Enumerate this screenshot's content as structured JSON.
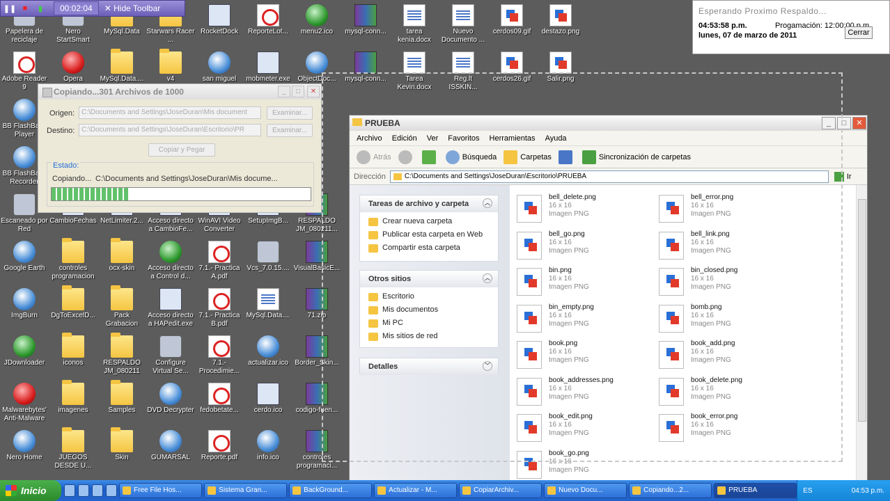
{
  "toolbar": {
    "time": "00:02:04",
    "hide_label": "Hide Toolbar"
  },
  "notification": {
    "title": "Esperando Proximo Respaldo...",
    "time": "04:53:58 p.m.",
    "prog_label": "Progamación: 12:00:00 p.m.",
    "date": "lunes, 07 de marzo de 2011",
    "close_label": "Cerrar"
  },
  "desktop_icons": [
    {
      "label": "Papelera de reciclaje",
      "icon": "recycle-bin-icon",
      "kind": "gear"
    },
    {
      "label": "Nero StartSmart",
      "icon": "nero-icon",
      "kind": "gear"
    },
    {
      "label": "MySql.Data",
      "icon": "folder-icon",
      "kind": "folder"
    },
    {
      "label": "Starwars Racer ...",
      "icon": "folder-icon",
      "kind": "folder"
    },
    {
      "label": "RocketDock",
      "icon": "rocketdock-icon",
      "kind": "prog"
    },
    {
      "label": "ReporteLot...",
      "icon": "pdf-icon",
      "kind": "pdf"
    },
    {
      "label": "menu2.ico",
      "icon": "ico-file-icon",
      "kind": "green"
    },
    {
      "label": "mysql-conn...",
      "icon": "rar-icon",
      "kind": "rar"
    },
    {
      "label": "tarea kenia.docx",
      "icon": "word-doc-icon",
      "kind": "doc"
    },
    {
      "label": "Nuevo Documento ...",
      "icon": "text-doc-icon",
      "kind": "doc"
    },
    {
      "label": "cerdos09.gif",
      "icon": "image-icon",
      "kind": "img"
    },
    {
      "label": "destazo.png",
      "icon": "image-icon",
      "kind": "img"
    },
    {
      "label": "Adobe Reader 9",
      "icon": "adobe-reader-icon",
      "kind": "pdf"
    },
    {
      "label": "Opera",
      "icon": "opera-icon",
      "kind": "red"
    },
    {
      "label": "MySql.Data....",
      "icon": "folder-icon",
      "kind": "folder"
    },
    {
      "label": "v4",
      "icon": "folder-icon",
      "kind": "folder"
    },
    {
      "label": "san miguel",
      "icon": "globe-icon",
      "kind": "round"
    },
    {
      "label": "mobmeter.exe",
      "icon": "monitor-icon",
      "kind": "prog"
    },
    {
      "label": "ObjectDoc...",
      "icon": "objectdoc-icon",
      "kind": "round"
    },
    {
      "label": "mysql-conn...",
      "icon": "rar-icon",
      "kind": "rar"
    },
    {
      "label": "Tarea Kevin.docx",
      "icon": "word-doc-icon",
      "kind": "doc"
    },
    {
      "label": "Reg.lt ISSKIN...",
      "icon": "text-doc-icon",
      "kind": "doc"
    },
    {
      "label": "cerdos26.gif",
      "icon": "image-icon",
      "kind": "img"
    },
    {
      "label": "Salir.png",
      "icon": "image-icon",
      "kind": "img"
    },
    {
      "label": "BB FlashBack Player",
      "icon": "flashback-icon",
      "kind": "round"
    },
    {
      "label": "BB FlashBack Recorder",
      "icon": "flashback-icon",
      "kind": "round"
    },
    {
      "label": "Escaneado por Red",
      "icon": "scanner-icon",
      "kind": "gear"
    },
    {
      "label": "CambioFechas",
      "icon": "app-icon",
      "kind": "prog"
    },
    {
      "label": "NetLimiter.2...",
      "icon": "app-icon",
      "kind": "prog"
    },
    {
      "label": "Acceso directo a CambioFe...",
      "icon": "shortcut-icon",
      "kind": "prog"
    },
    {
      "label": "WinAVI Video Converter",
      "icon": "winavi-icon",
      "kind": "prog"
    },
    {
      "label": "SetupImgB...",
      "icon": "setup-icon",
      "kind": "prog"
    },
    {
      "label": "RESPALDO JM_080211...",
      "icon": "rar-icon",
      "kind": "rar"
    },
    {
      "label": "Google Earth",
      "icon": "google-earth-icon",
      "kind": "round"
    },
    {
      "label": "controles programacion",
      "icon": "folder-icon",
      "kind": "folder"
    },
    {
      "label": "ocx-skin",
      "icon": "folder-icon",
      "kind": "folder"
    },
    {
      "label": "Acceso directo a Control d...",
      "icon": "shortcut-icon",
      "kind": "green"
    },
    {
      "label": "7.1.- Practica A.pdf",
      "icon": "pdf-icon",
      "kind": "pdf"
    },
    {
      "label": "Vcs_7.0.15....",
      "icon": "setup-icon",
      "kind": "gear"
    },
    {
      "label": "VisualBasicE...",
      "icon": "rar-icon",
      "kind": "rar"
    },
    {
      "label": "ImgBurn",
      "icon": "imgburn-icon",
      "kind": "round"
    },
    {
      "label": "DgToExcelD...",
      "icon": "folder-icon",
      "kind": "folder"
    },
    {
      "label": "Pack Grabacion",
      "icon": "folder-icon",
      "kind": "folder"
    },
    {
      "label": "Acceso directo a HAPedit.exe",
      "icon": "shortcut-icon",
      "kind": "prog"
    },
    {
      "label": "7.1.- Practica B.pdf",
      "icon": "pdf-icon",
      "kind": "pdf"
    },
    {
      "label": "MySql.Data....",
      "icon": "help-file-icon",
      "kind": "doc"
    },
    {
      "label": "71.zip",
      "icon": "rar-icon",
      "kind": "rar"
    },
    {
      "label": "JDownloader",
      "icon": "jdownloader-icon",
      "kind": "green"
    },
    {
      "label": "iconos",
      "icon": "folder-icon",
      "kind": "folder"
    },
    {
      "label": "RESPALDO JM_080211",
      "icon": "folder-icon",
      "kind": "folder"
    },
    {
      "label": "Configure Virtual Se...",
      "icon": "configure-icon",
      "kind": "gear"
    },
    {
      "label": "7.1.- Procedimie...",
      "icon": "pdf-icon",
      "kind": "pdf"
    },
    {
      "label": "actualizar.ico",
      "icon": "ico-file-icon",
      "kind": "round"
    },
    {
      "label": "Border_Skin...",
      "icon": "rar-icon",
      "kind": "rar"
    },
    {
      "label": "Malwarebytes' Anti-Malware",
      "icon": "malwarebytes-icon",
      "kind": "red"
    },
    {
      "label": "imagenes",
      "icon": "folder-icon",
      "kind": "folder"
    },
    {
      "label": "Samples",
      "icon": "folder-icon",
      "kind": "folder"
    },
    {
      "label": "DVD Decrypter",
      "icon": "dvd-icon",
      "kind": "round"
    },
    {
      "label": "fedobetate...",
      "icon": "pdf-icon",
      "kind": "pdf"
    },
    {
      "label": "cerdo.ico",
      "icon": "ico-file-icon",
      "kind": "prog"
    },
    {
      "label": "codigo-fuen...",
      "icon": "rar-icon",
      "kind": "rar"
    },
    {
      "label": "Nero Home",
      "icon": "nero-home-icon",
      "kind": "round"
    },
    {
      "label": "JUEGOS DESDE U...",
      "icon": "folder-icon",
      "kind": "folder"
    },
    {
      "label": "Skin",
      "icon": "folder-icon",
      "kind": "folder"
    },
    {
      "label": "GUMARSAL",
      "icon": "globe-icon",
      "kind": "round"
    },
    {
      "label": "Reporte.pdf",
      "icon": "pdf-icon",
      "kind": "pdf"
    },
    {
      "label": "info.ico",
      "icon": "info-icon",
      "kind": "round"
    },
    {
      "label": "controles programaci...",
      "icon": "rar-icon",
      "kind": "rar"
    }
  ],
  "copy_dialog": {
    "title": "Copiando...301 Archivos de 1000",
    "origen_label": "Origen:",
    "origen_value": "C:\\Documents and Settings\\JoseDuran\\Mis document",
    "destino_label": "Destino:",
    "destino_value": "C:\\Documents and Settings\\JoseDuran\\Escritorio\\PR",
    "examinar": "Examinar...",
    "copy_button": "Copiar y Pegar",
    "estado_label": "Estado:",
    "status_prefix": "Copiando...",
    "status_path": "C:\\Documents and Settings\\JoseDuran\\Mis docume...",
    "progress_fraction": 0.3
  },
  "explorer": {
    "title": "PRUEBA",
    "menu": [
      "Archivo",
      "Edición",
      "Ver",
      "Favoritos",
      "Herramientas",
      "Ayuda"
    ],
    "back": "Atrás",
    "search": "Búsqueda",
    "folders": "Carpetas",
    "sync": "Sincronización de carpetas",
    "address_label": "Dirección",
    "address": "C:\\Documents and Settings\\JoseDuran\\Escritorio\\PRUEBA",
    "go": "Ir",
    "tasks_title": "Tareas de archivo y carpeta",
    "tasks": [
      "Crear nueva carpeta",
      "Publicar esta carpeta en Web",
      "Compartir esta carpeta"
    ],
    "other_title": "Otros sitios",
    "other": [
      "Escritorio",
      "Mis documentos",
      "Mi PC",
      "Mis sitios de red"
    ],
    "details_title": "Detalles",
    "files": [
      {
        "name": "bell_delete.png",
        "dim": "16 x 16",
        "type": "Imagen PNG"
      },
      {
        "name": "bell_error.png",
        "dim": "16 x 16",
        "type": "Imagen PNG"
      },
      {
        "name": "bell_go.png",
        "dim": "16 x 16",
        "type": "Imagen PNG"
      },
      {
        "name": "bell_link.png",
        "dim": "16 x 16",
        "type": "Imagen PNG"
      },
      {
        "name": "bin.png",
        "dim": "16 x 16",
        "type": "Imagen PNG"
      },
      {
        "name": "bin_closed.png",
        "dim": "16 x 16",
        "type": "Imagen PNG"
      },
      {
        "name": "bin_empty.png",
        "dim": "16 x 16",
        "type": "Imagen PNG"
      },
      {
        "name": "bomb.png",
        "dim": "16 x 16",
        "type": "Imagen PNG"
      },
      {
        "name": "book.png",
        "dim": "16 x 16",
        "type": "Imagen PNG"
      },
      {
        "name": "book_add.png",
        "dim": "16 x 16",
        "type": "Imagen PNG"
      },
      {
        "name": "book_addresses.png",
        "dim": "16 x 16",
        "type": "Imagen PNG"
      },
      {
        "name": "book_delete.png",
        "dim": "16 x 16",
        "type": "Imagen PNG"
      },
      {
        "name": "book_edit.png",
        "dim": "16 x 16",
        "type": "Imagen PNG"
      },
      {
        "name": "book_error.png",
        "dim": "16 x 16",
        "type": "Imagen PNG"
      },
      {
        "name": "book_go.png",
        "dim": "16 x 16",
        "type": "Imagen PNG"
      }
    ]
  },
  "taskbar": {
    "start": "Inicio",
    "tasks": [
      "Free File Hos...",
      "Sistema Gran...",
      "BackGround...",
      "Actualizar - M...",
      "CopiarArchiv...",
      "Nuevo Docu...",
      "Copiando...2...",
      "PRUEBA"
    ],
    "lang": "ES",
    "clock": "04:53 p.m."
  }
}
